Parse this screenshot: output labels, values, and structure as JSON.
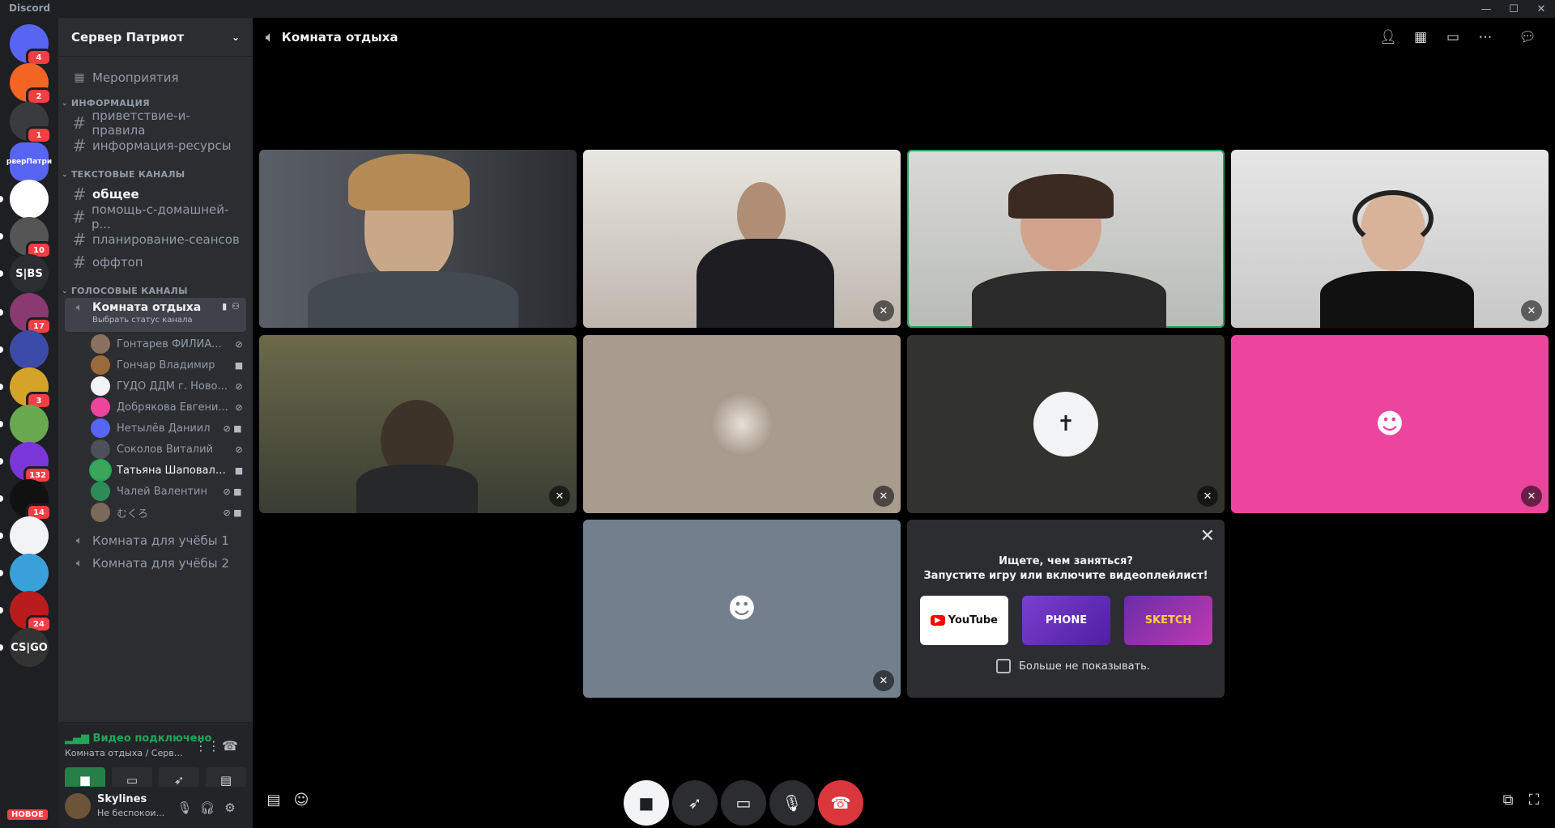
{
  "app": {
    "title": "Discord"
  },
  "servers": [
    {
      "name": "Discord",
      "badge": "4",
      "color": "#5865f2"
    },
    {
      "name": "server-fox",
      "badge": "2",
      "color": "#f26522"
    },
    {
      "name": "server-turtle",
      "badge": "1",
      "color": "#3a3b3f"
    },
    {
      "name": "Сервер Патриот",
      "label": "рверПатри",
      "badge": "",
      "color": "#5865f2"
    },
    {
      "name": "server-face",
      "badge": "",
      "color": "#ffffff"
    },
    {
      "name": "server-anime",
      "badge": "10",
      "color": "#555"
    },
    {
      "name": "S|BS",
      "label": "S|BS",
      "badge": "",
      "color": "#2b2d31"
    },
    {
      "name": "server-purple",
      "badge": "17",
      "color": "#8a3a6f"
    },
    {
      "name": "server-pirate",
      "badge": "",
      "color": "#3c4aa8"
    },
    {
      "name": "server-yellow",
      "badge": "3",
      "color": "#d6a32a"
    },
    {
      "name": "server-green",
      "badge": "",
      "color": "#6aa84f"
    },
    {
      "name": "server-gaming",
      "badge": "132",
      "color": "#7b36d9"
    },
    {
      "name": "server-mask",
      "badge": "14",
      "color": "#111"
    },
    {
      "name": "server-sail",
      "badge": "",
      "color": "#f2f3f5"
    },
    {
      "name": "server-blue",
      "badge": "",
      "color": "#3aa0d9"
    },
    {
      "name": "server-a",
      "badge": "24",
      "color": "#b91c1c"
    },
    {
      "name": "CSGO RU",
      "label": "CS|GO",
      "badge": "",
      "color": "#333"
    }
  ],
  "new_label": "НОВОЕ",
  "sidebar": {
    "server_name": "Сервер Патриот",
    "events": "Мероприятия",
    "categories": {
      "info": "ИНФОРМАЦИЯ",
      "text": "ТЕКСТОВЫЕ КАНАЛЫ",
      "voice": "ГОЛОСОВЫЕ КАНАЛЫ"
    },
    "info_channels": [
      "приветствие-и-правила",
      "информация-ресурсы"
    ],
    "text_channels": [
      "общее",
      "помощь-с-домашней-р...",
      "планирование-сеансов",
      "оффтоп"
    ],
    "voice_channel": {
      "name": "Комната отдыха",
      "status": "Выбрать статус канала"
    },
    "voice_users": [
      {
        "name": "Гонтарев ФИЛИА...",
        "icon": "mute",
        "color": "#8a7260"
      },
      {
        "name": "Гончар Владимир",
        "icon": "video",
        "color": "#9a6a3a"
      },
      {
        "name": "ГУДО ДДМ г. Ново...",
        "icon": "mute",
        "color": "#f2f3f5"
      },
      {
        "name": "Добрякова Евгени...",
        "icon": "mute",
        "color": "#eb459e"
      },
      {
        "name": "Нетылёв Даниил",
        "icon": "mute-video",
        "color": "#5865f2"
      },
      {
        "name": "Соколов Виталий",
        "icon": "mute",
        "color": "#4e5058"
      },
      {
        "name": "Татьяна Шаповало...",
        "icon": "video",
        "color": "#3ba55c",
        "speaking": true
      },
      {
        "name": "Чалей Валентин",
        "icon": "mute-video",
        "color": "#2e8b57"
      },
      {
        "name": "むくろ",
        "icon": "mute-video",
        "color": "#7a6a5a"
      }
    ],
    "other_voice": [
      "Комната для учёбы 1",
      "Комната для учёбы 2"
    ],
    "voice_panel": {
      "status": "Видео подключено",
      "sub": "Комната отдыха / Сервер ..."
    },
    "user": {
      "name": "Skylines",
      "status": "Не беспокои..."
    }
  },
  "main": {
    "title": "Комната отдыха",
    "activity": {
      "line1": "Ищете, чем заняться?",
      "line2": "Запустите игру или включите видеоплейлист!",
      "youtube": "YouTube",
      "game1": "PHONE",
      "game2": "SKETCH",
      "dont_show": "Больше не показывать."
    }
  },
  "colors": {
    "accent": "#5865f2",
    "green": "#23a559",
    "red": "#da373c",
    "pink": "#eb459e"
  }
}
